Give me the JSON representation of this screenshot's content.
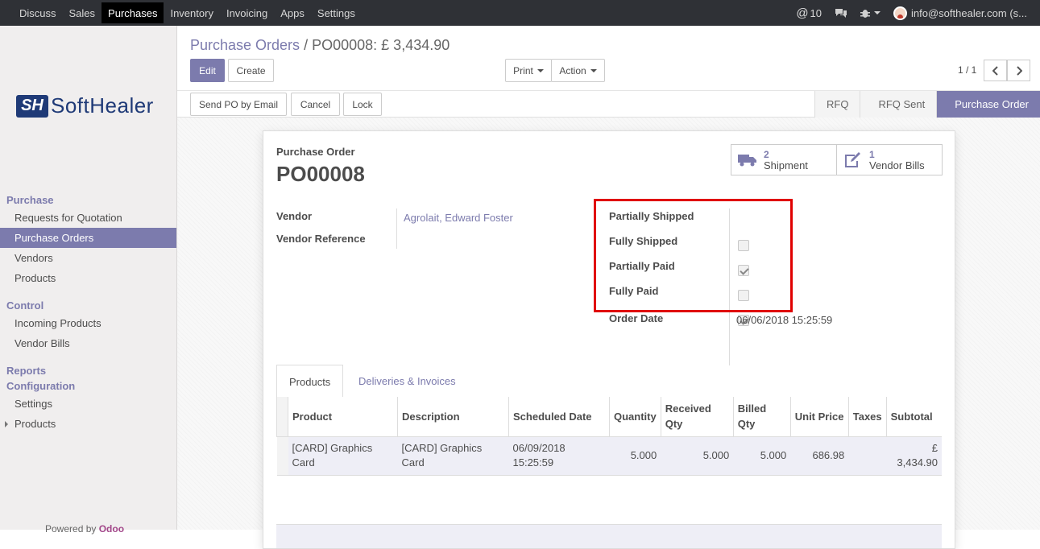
{
  "topbar": {
    "menu": [
      "Discuss",
      "Sales",
      "Purchases",
      "Inventory",
      "Invoicing",
      "Apps",
      "Settings"
    ],
    "active_menu": "Purchases",
    "mentions": "10",
    "user": "info@softhealer.com (s..."
  },
  "sidebar": {
    "logo_mark": "SH",
    "logo_text": "SoftHealer",
    "sections": [
      {
        "title": "Purchase",
        "items": [
          "Requests for Quotation",
          "Purchase Orders",
          "Vendors",
          "Products"
        ]
      },
      {
        "title": "Control",
        "items": [
          "Incoming Products",
          "Vendor Bills"
        ]
      },
      {
        "title": "Reports",
        "items": []
      },
      {
        "title": "Configuration",
        "items": [
          "Settings",
          "Products"
        ]
      }
    ],
    "active_item": "Purchase Orders",
    "powered_by": "Powered by",
    "powered_brand": "Odoo"
  },
  "breadcrumb": {
    "parent": "Purchase Orders",
    "separator": "/",
    "current": "PO00008: £ 3,434.90"
  },
  "buttons": {
    "edit": "Edit",
    "create": "Create",
    "print": "Print",
    "action": "Action",
    "send_po": "Send PO by Email",
    "cancel": "Cancel",
    "lock": "Lock"
  },
  "pager": "1 / 1",
  "statusbar": [
    "RFQ",
    "RFQ Sent",
    "Purchase Order"
  ],
  "status_current": "Purchase Order",
  "smart_buttons": {
    "shipment": {
      "count": "2",
      "label": "Shipment"
    },
    "bills": {
      "count": "1",
      "label": "Vendor Bills"
    }
  },
  "form": {
    "subtitle": "Purchase Order",
    "name": "PO00008",
    "vendor_label": "Vendor",
    "vendor_value": "Agrolait, Edward Foster",
    "vendor_ref_label": "Vendor Reference",
    "flags": [
      {
        "label": "Partially Shipped",
        "checked": false
      },
      {
        "label": "Fully Shipped",
        "checked": true
      },
      {
        "label": "Partially Paid",
        "checked": false
      },
      {
        "label": "Fully Paid",
        "checked": true
      }
    ],
    "order_date_label": "Order Date",
    "order_date_value": "06/06/2018 15:25:59"
  },
  "tabs": [
    "Products",
    "Deliveries & Invoices"
  ],
  "active_tab": "Products",
  "lines": {
    "headers": [
      "Product",
      "Description",
      "Scheduled Date",
      "Quantity",
      "Received Qty",
      "Billed Qty",
      "Unit Price",
      "Taxes",
      "Subtotal"
    ],
    "rows": [
      {
        "product": "[CARD] Graphics Card",
        "description": "[CARD] Graphics Card",
        "scheduled": "06/09/2018 15:25:59",
        "quantity": "5.000",
        "received": "5.000",
        "billed": "5.000",
        "unit_price": "686.98",
        "taxes": "",
        "subtotal": "£ 3,434.90"
      }
    ]
  },
  "colors": {
    "brand": "#7c7bad",
    "topbar": "#2f3136",
    "highlight": "#e00000"
  }
}
